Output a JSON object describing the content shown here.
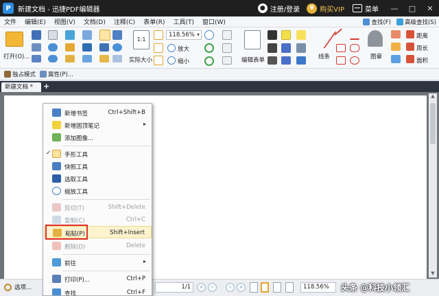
{
  "titlebar": {
    "logo": "P",
    "title": "新建文档 - 迅捷PDF编辑器",
    "register": "注册/登录",
    "vip": "购买VIP",
    "menu": "菜单",
    "vip_badge": "¥",
    "minimize": "—",
    "maximize": "□",
    "close": "✕"
  },
  "menubar": {
    "items": [
      "文件",
      "编辑(E)",
      "视图(V)",
      "文档(D)",
      "注释(C)",
      "表单(R)",
      "工具(T)",
      "窗口(W)"
    ],
    "find": "查找(F)",
    "advanced_find": "高级查找(S)"
  },
  "ribbon": {
    "open": "打开(O)...",
    "actual_size": "实际大小",
    "zoom_value": "118.56%",
    "zoom_in": "放大",
    "zoom_out": "缩小",
    "edit_form": "编辑表单",
    "line": "线条",
    "stamp": "图章",
    "distance": "距离",
    "perimeter": "周长",
    "area": "面积",
    "actual_size_badge": "1:1"
  },
  "subbar": {
    "exclusive_mode": "独占模式",
    "properties": "属性(P)..."
  },
  "tabs": {
    "doc_tab": "新建文档 *",
    "add": "+"
  },
  "context_menu": {
    "items": [
      {
        "label": "新增书签",
        "key": "Ctrl+Shift+B",
        "icon": "bookmark-icon"
      },
      {
        "label": "新增固顶笔记",
        "key": "",
        "icon": "sticky-note-icon",
        "submenu": true
      },
      {
        "label": "添加图像...",
        "key": "",
        "icon": "image-icon"
      },
      {
        "label": "手形工具",
        "key": "",
        "icon": "hand-icon",
        "checked": true
      },
      {
        "label": "快照工具",
        "key": "",
        "icon": "camera-icon"
      },
      {
        "label": "选取工具",
        "key": "",
        "icon": "text-select-icon"
      },
      {
        "label": "缩放工具",
        "key": "",
        "icon": "zoom-icon"
      },
      {
        "label": "剪切(T)",
        "key": "Shift+Delete",
        "icon": "scissors-icon",
        "disabled": true
      },
      {
        "label": "复制(C)",
        "key": "Ctrl+C",
        "icon": "copy-icon",
        "disabled": true
      },
      {
        "label": "粘贴(P)",
        "key": "Shift+Insert",
        "icon": "paste-icon",
        "highlighted": true
      },
      {
        "label": "删除(D)",
        "key": "Delete",
        "icon": "delete-icon",
        "disabled": true
      },
      {
        "label": "前往",
        "key": "",
        "icon": "goto-icon",
        "submenu": true
      },
      {
        "label": "打印(P)...",
        "key": "Ctrl+P",
        "icon": "print-icon"
      },
      {
        "label": "查找",
        "key": "Ctrl+F",
        "icon": "find-icon"
      }
    ],
    "check_mark": "✓",
    "submenu_arrow": "▸"
  },
  "statusbar": {
    "options": "选项...",
    "page": "1/1",
    "zoom": "118.56%",
    "nav_first": "«",
    "nav_prev": "‹",
    "nav_next": "›",
    "nav_last": "»",
    "nav_back": "◂",
    "nav_forward": "▸"
  },
  "watermark": "头条 @科技小领汇",
  "colors": {
    "titlebar_bg": "#1f1f1f",
    "highlight_border": "#e0302a",
    "menu_highlight": "#fdf3cf",
    "vip": "#f2c24e"
  }
}
